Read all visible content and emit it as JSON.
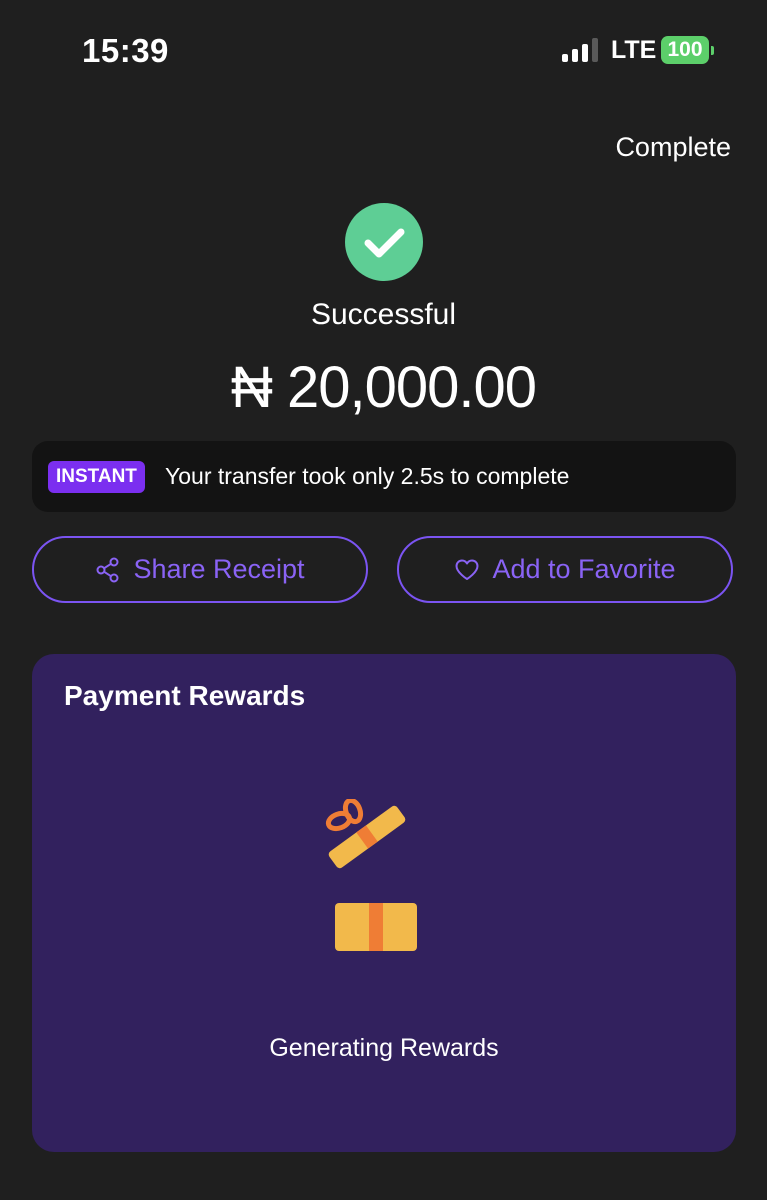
{
  "status_bar": {
    "time": "15:39",
    "network": "LTE",
    "battery": "100"
  },
  "header": {
    "complete_label": "Complete"
  },
  "result": {
    "status": "Successful",
    "amount": "₦ 20,000.00"
  },
  "instant_banner": {
    "badge": "INSTANT",
    "message": "Your transfer took only 2.5s to complete"
  },
  "actions": {
    "share_label": "Share Receipt",
    "favorite_label": "Add to Favorite"
  },
  "rewards": {
    "title": "Payment Rewards",
    "status": "Generating Rewards"
  },
  "colors": {
    "background": "#1f1f1f",
    "success_green": "#5ece95",
    "accent_purple": "#7b54f2",
    "badge_purple": "#7b2ff0",
    "rewards_bg": "#32215e",
    "battery_green": "#5ccf6a",
    "gift_yellow": "#f2b94b",
    "gift_orange": "#ef7d35"
  },
  "icons": {
    "success": "check-icon",
    "share": "share-icon",
    "favorite": "heart-icon",
    "rewards": "gift-icon"
  }
}
